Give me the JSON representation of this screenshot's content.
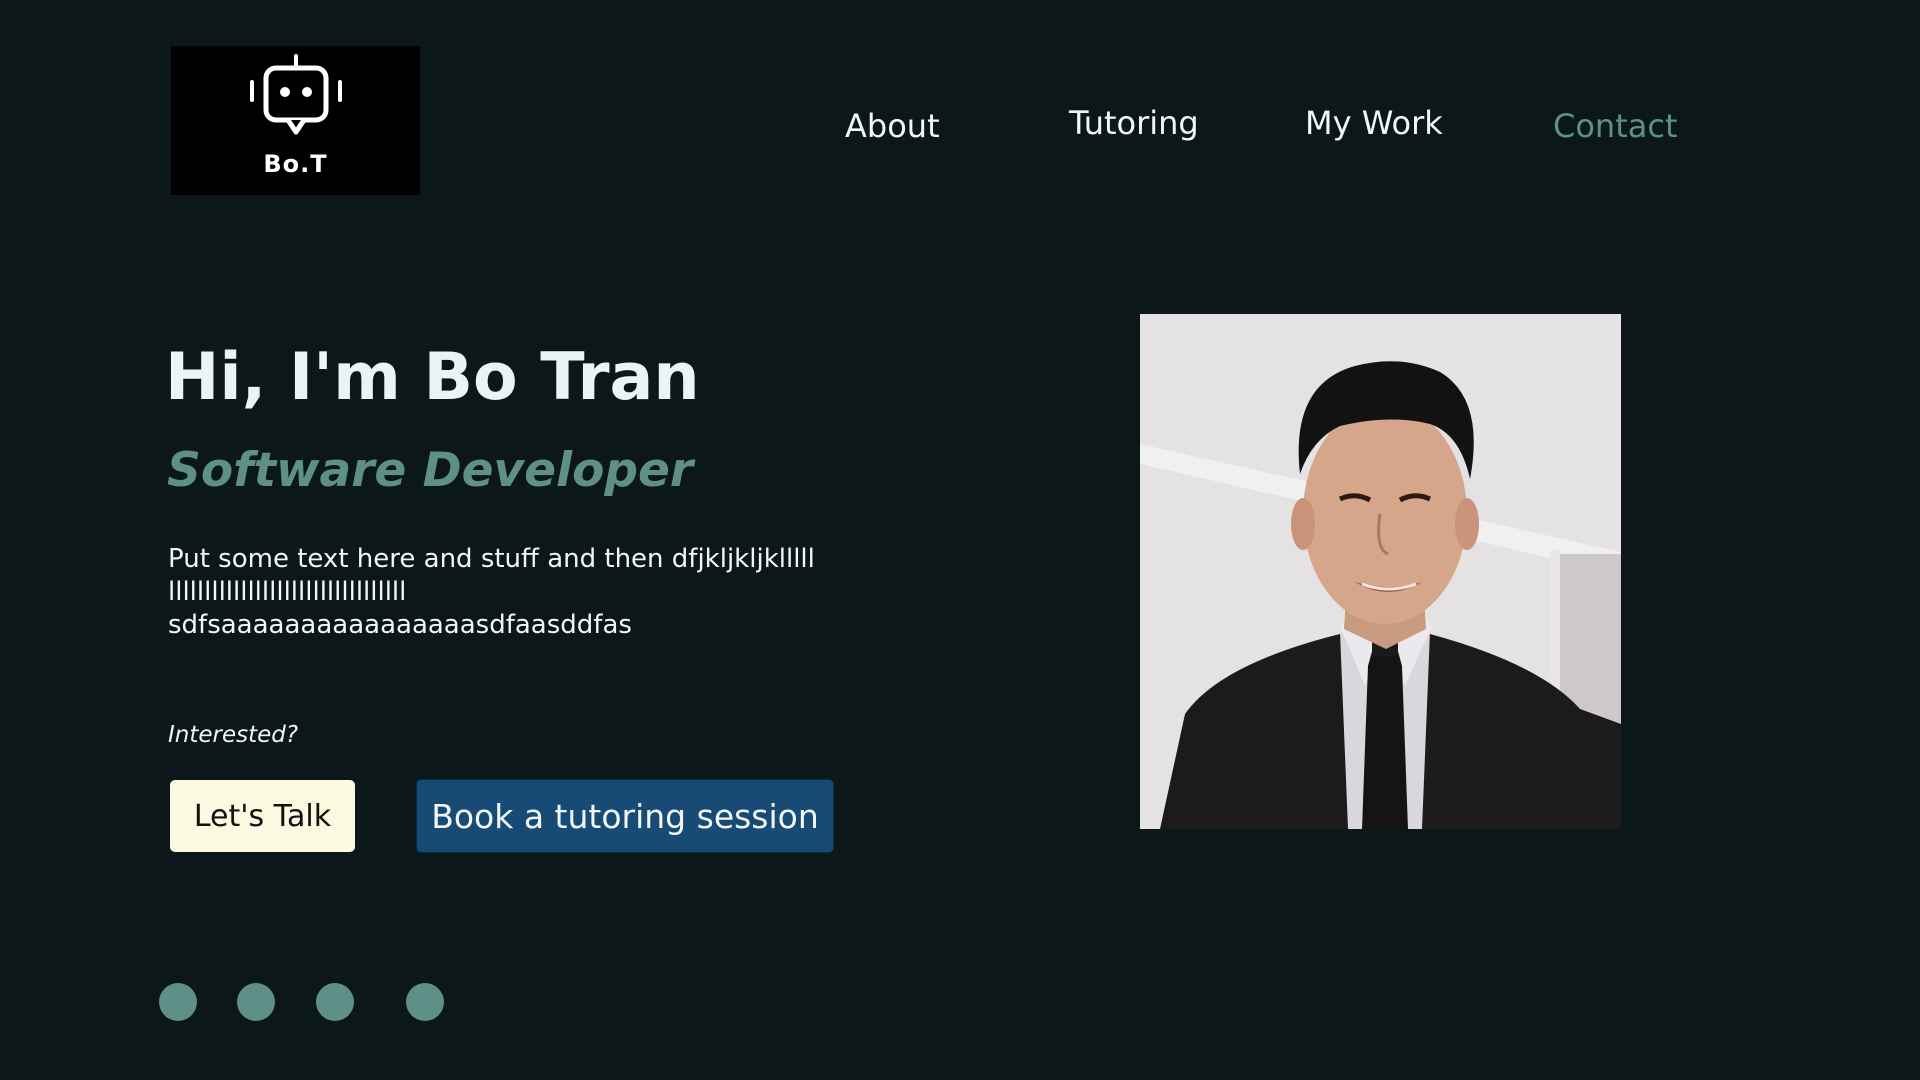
{
  "logo": {
    "text": "Bo.T",
    "icon": "robot-chat-icon"
  },
  "nav": {
    "items": [
      {
        "label": "About"
      },
      {
        "label": "Tutoring"
      },
      {
        "label": "My Work"
      },
      {
        "label": "Contact"
      }
    ]
  },
  "hero": {
    "title": "Hi, I'm Bo Tran",
    "subtitle": "Software Developer",
    "body_line1": "Put some text here and stuff and then  dfjkljkljklllll",
    "body_line2": "lllllllllllllllllllllllllllllllll",
    "body_line3": "sdfsaaaaaaaaaaaaaaaasdfaasddfas",
    "interested": "Interested?",
    "cta_primary": "Let's Talk",
    "cta_secondary": "Book a tutoring session"
  },
  "colors": {
    "background": "#0b1718",
    "accent": "#5e9088",
    "cta_primary_bg": "#fbfae0",
    "cta_secondary_bg": "#174a74"
  },
  "pagination": {
    "count": 4,
    "icon": "dot-indicator"
  }
}
